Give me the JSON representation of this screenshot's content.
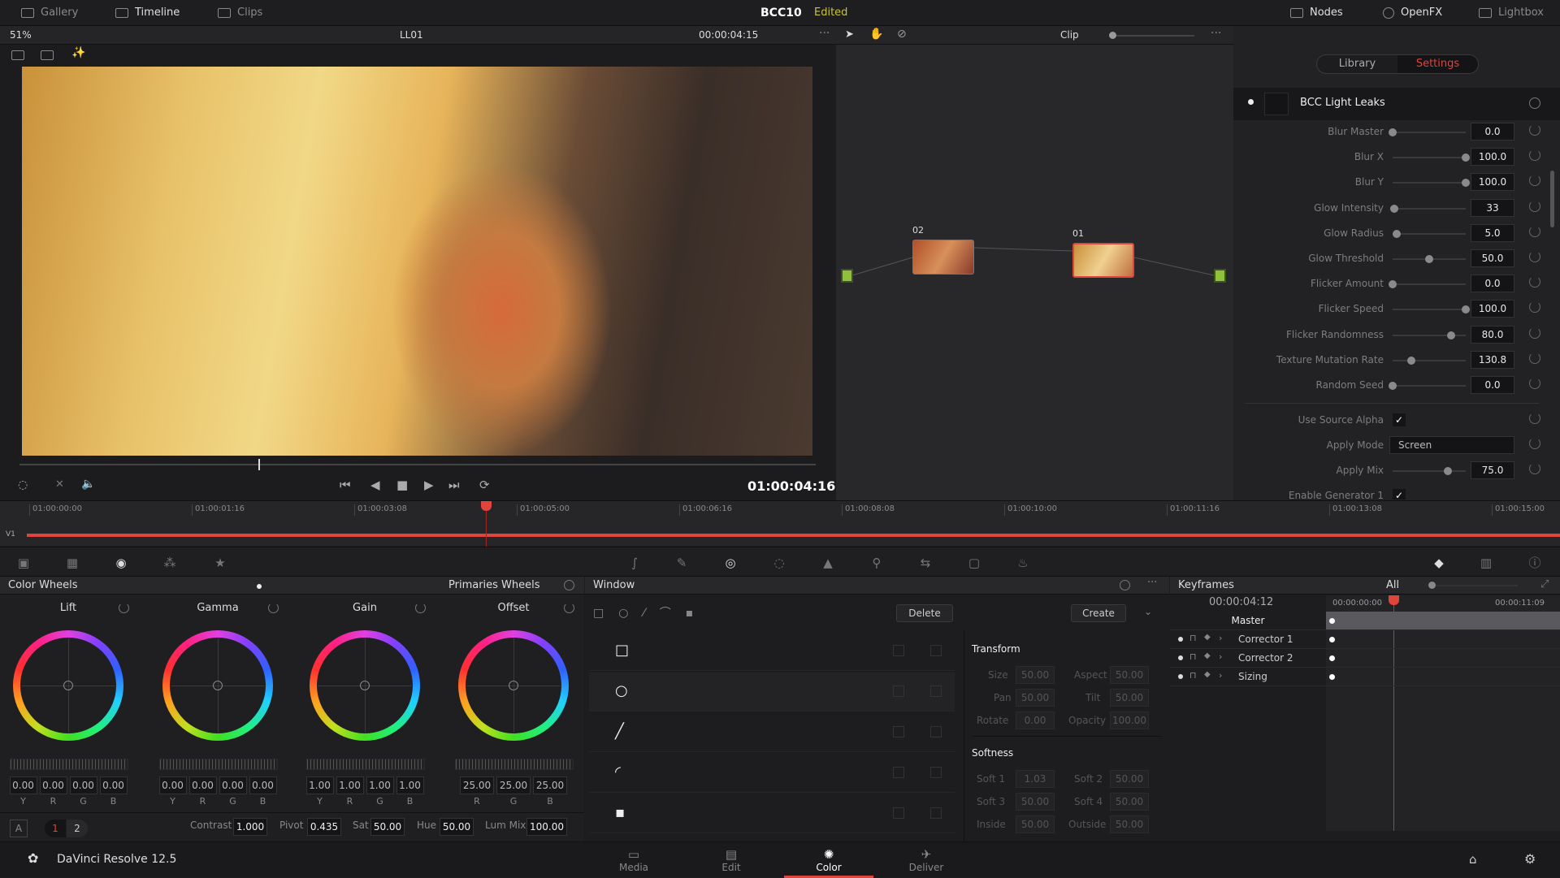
{
  "topbar": {
    "gallery": "Gallery",
    "timeline": "Timeline",
    "clips": "Clips",
    "project": "BCC10",
    "status": "Edited",
    "nodes": "Nodes",
    "openfx": "OpenFX",
    "lightbox": "Lightbox"
  },
  "viewer": {
    "zoom": "51%",
    "clip_name": "LL01",
    "timecode_top": "00:00:04:15",
    "mode": "Clip",
    "timecode": "01:00:04:16",
    "scrub_position": 0.3
  },
  "nodes": [
    {
      "label": "02"
    },
    {
      "label": "01"
    }
  ],
  "settings": {
    "tabs": [
      "Library",
      "Settings"
    ],
    "active_tab": "Settings",
    "effect_name": "BCC Light Leaks",
    "params": [
      {
        "label": "Blur Master",
        "value": "0.0",
        "level": 0
      },
      {
        "label": "Blur X",
        "value": "100.0",
        "level": 1
      },
      {
        "label": "Blur Y",
        "value": "100.0",
        "level": 1
      },
      {
        "label": "Glow Intensity",
        "value": "33",
        "level": 0.02
      },
      {
        "label": "Glow Radius",
        "value": "5.0",
        "level": 0.05
      },
      {
        "label": "Glow Threshold",
        "value": "50.0",
        "level": 0.5
      },
      {
        "label": "Flicker Amount",
        "value": "0.0",
        "level": 0
      },
      {
        "label": "Flicker Speed",
        "value": "100.0",
        "level": 1
      },
      {
        "label": "Flicker Randomness",
        "value": "80.0",
        "level": 0.8
      },
      {
        "label": "Texture Mutation Rate",
        "value": "130.8",
        "level": 0.26
      },
      {
        "label": "Random Seed",
        "value": "0.0",
        "level": 0
      }
    ],
    "use_source_alpha": {
      "label": "Use Source Alpha",
      "checked": true
    },
    "apply_mode": {
      "label": "Apply Mode",
      "value": "Screen"
    },
    "apply_mix": {
      "label": "Apply Mix",
      "value": "75.0",
      "level": 0.75
    },
    "enable_generator": {
      "label": "Enable Generator 1",
      "checked": true
    }
  },
  "timeline": {
    "track": "V1",
    "ticks": [
      "01:00:00:00",
      "01:00:01:16",
      "01:00:03:08",
      "01:00:05:00",
      "01:00:06:16",
      "01:00:08:08",
      "01:00:10:00",
      "01:00:11:16",
      "01:00:13:08",
      "01:00:15:00"
    ],
    "playhead_fraction": 0.3
  },
  "color_wheels": {
    "title": "Color Wheels",
    "mode": "Primaries Wheels",
    "wheels": [
      {
        "name": "Lift",
        "values": [
          "0.00",
          "0.00",
          "0.00",
          "0.00"
        ],
        "channels": [
          "Y",
          "R",
          "G",
          "B"
        ]
      },
      {
        "name": "Gamma",
        "values": [
          "0.00",
          "0.00",
          "0.00",
          "0.00"
        ],
        "channels": [
          "Y",
          "R",
          "G",
          "B"
        ]
      },
      {
        "name": "Gain",
        "values": [
          "1.00",
          "1.00",
          "1.00",
          "1.00"
        ],
        "channels": [
          "Y",
          "R",
          "G",
          "B"
        ]
      },
      {
        "name": "Offset",
        "values": [
          "25.00",
          "25.00",
          "25.00"
        ],
        "channels": [
          "R",
          "G",
          "B"
        ]
      }
    ],
    "bottom": {
      "a": "A",
      "page1": "1",
      "page2": "2",
      "contrast_label": "Contrast",
      "contrast": "1.000",
      "pivot_label": "Pivot",
      "pivot": "0.435",
      "sat_label": "Sat",
      "sat": "50.00",
      "hue_label": "Hue",
      "hue": "50.00",
      "lummix_label": "Lum Mix",
      "lummix": "100.00"
    }
  },
  "window": {
    "title": "Window",
    "delete": "Delete",
    "create": "Create",
    "transform_title": "Transform",
    "transform": [
      [
        "Size",
        "50.00",
        "Aspect",
        "50.00"
      ],
      [
        "Pan",
        "50.00",
        "Tilt",
        "50.00"
      ],
      [
        "Rotate",
        "0.00",
        "Opacity",
        "100.00"
      ]
    ],
    "softness_title": "Softness",
    "softness": [
      [
        "Soft 1",
        "1.03",
        "Soft 2",
        "50.00"
      ],
      [
        "Soft 3",
        "50.00",
        "Soft 4",
        "50.00"
      ],
      [
        "Inside",
        "50.00",
        "Outside",
        "50.00"
      ]
    ]
  },
  "keyframes": {
    "title": "Keyframes",
    "filter": "All",
    "timecode": "00:00:04:12",
    "ruler_start": "00:00:00:00",
    "ruler_end": "00:00:11:09",
    "tracks": [
      "Master",
      "Corrector 1",
      "Corrector 2",
      "Sizing"
    ]
  },
  "app": {
    "name": "DaVinci Resolve 12.5"
  },
  "pages": [
    {
      "label": "Media"
    },
    {
      "label": "Edit"
    },
    {
      "label": "Color",
      "active": true
    },
    {
      "label": "Deliver"
    }
  ],
  "colors": {
    "accent": "#e0443a",
    "edited": "#c9c23a",
    "node_green": "#8fc23a"
  }
}
